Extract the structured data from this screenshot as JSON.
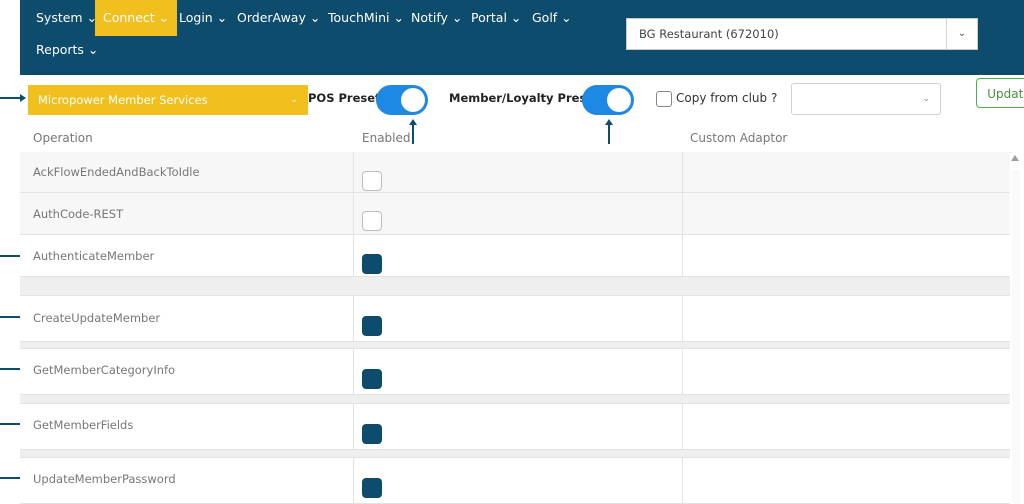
{
  "nav": {
    "items": [
      {
        "label": "System ⌄"
      },
      {
        "label": "Connect ⌄"
      },
      {
        "label": "Login ⌄"
      },
      {
        "label": "OrderAway ⌄"
      },
      {
        "label": "TouchMini ⌄"
      },
      {
        "label": "Notify ⌄"
      },
      {
        "label": "Portal ⌄"
      },
      {
        "label": "Golf ⌄"
      },
      {
        "label": "Reports ⌄"
      }
    ],
    "active": "Connect",
    "restaurant": "BG Restaurant (672010)"
  },
  "toolbar": {
    "service": "Micropower Member Services",
    "pos_presets_label": "POS Presets",
    "pos_presets_on": true,
    "member_presets_label": "Member/Loyalty Presets",
    "member_presets_on": true,
    "copy_from_club_label": "Copy from club ?",
    "copy_from_club_checked": false,
    "club_value": "",
    "update_label": "Update"
  },
  "table": {
    "headers": {
      "operation": "Operation",
      "enabled": "Enabled",
      "custom_adaptor": "Custom Adaptor"
    },
    "rows": [
      {
        "operation": "AckFlowEndedAndBackToIdle",
        "enabled": false,
        "custom_adaptor": ""
      },
      {
        "operation": "AuthCode-REST",
        "enabled": false,
        "custom_adaptor": ""
      },
      {
        "operation": "AuthenticateMember",
        "enabled": true,
        "custom_adaptor": ""
      },
      {
        "operation": "CreateUpdateMember",
        "enabled": true,
        "custom_adaptor": ""
      },
      {
        "operation": "GetMemberCategoryInfo",
        "enabled": true,
        "custom_adaptor": ""
      },
      {
        "operation": "GetMemberFields",
        "enabled": true,
        "custom_adaptor": ""
      },
      {
        "operation": "UpdateMemberPassword",
        "enabled": true,
        "custom_adaptor": ""
      }
    ]
  },
  "colors": {
    "navbar": "#0d4c6c",
    "accent": "#f2c01e",
    "toggle": "#1e88e5",
    "checked": "#0d4c6c",
    "update_border": "#4caf50"
  },
  "icons": [
    "chevron-down-icon",
    "scroll-up-arrow-icon",
    "annotation-arrow-icon"
  ]
}
